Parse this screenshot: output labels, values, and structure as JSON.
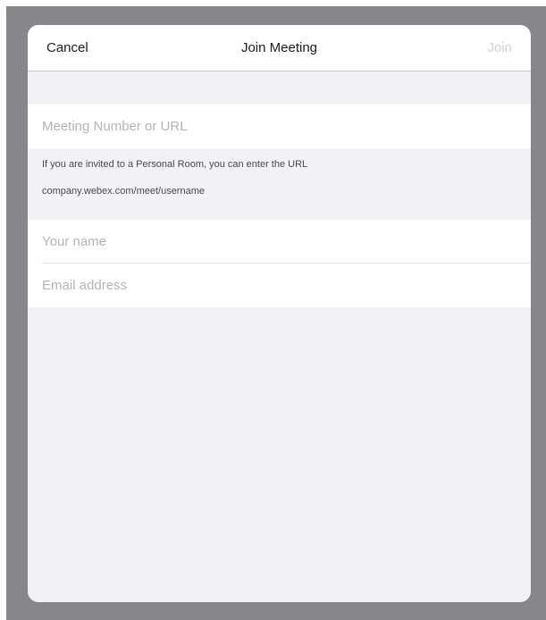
{
  "navbar": {
    "cancel_label": "Cancel",
    "title": "Join Meeting",
    "join_label": "Join"
  },
  "form": {
    "meeting_number": {
      "value": "",
      "placeholder": "Meeting Number or URL"
    },
    "hint": {
      "line1": "If you are invited to a Personal Room, you can enter the URL",
      "line2": "company.webex.com/meet/username"
    },
    "name": {
      "value": "",
      "placeholder": "Your name"
    },
    "email": {
      "value": "",
      "placeholder": "Email address"
    }
  },
  "colors": {
    "backdrop": "#86868b",
    "sheet_background": "#f2f2f6",
    "join_disabled": "#d1d1d6",
    "placeholder": "#b4b4b8"
  }
}
